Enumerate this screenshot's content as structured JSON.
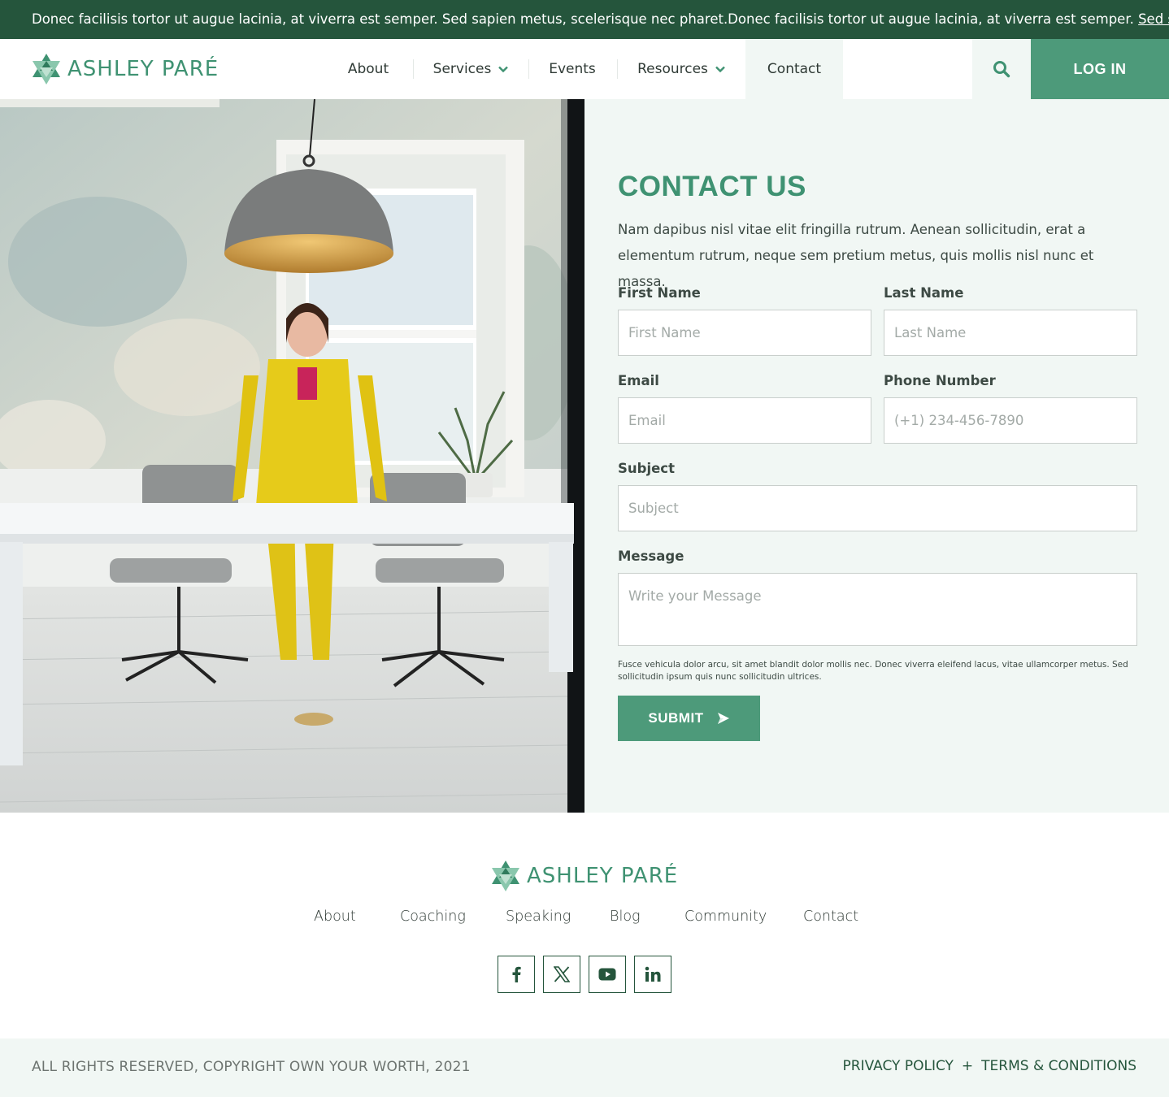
{
  "announcement": {
    "text": "Donec facilisis tortor ut augue lacinia, at viverra est semper. Sed sapien metus, scelerisque nec pharet.Donec facilisis tortor ut augue lacinia, at viverra est semper. ",
    "link": "Sed sapien",
    "trailing": "."
  },
  "brand": {
    "name": "ASHLEY PARÉ",
    "accent": "#3f9272",
    "dark_green": "#25553c",
    "button_green": "#4d9a7a",
    "panel_bg": "#f1f7f4"
  },
  "nav": {
    "items": [
      {
        "label": "About"
      },
      {
        "label": "Services",
        "icon": "chevron-down-icon"
      },
      {
        "label": "Events"
      },
      {
        "label": "Resources",
        "icon": "chevron-down-icon"
      },
      {
        "label": "Contact",
        "active": true
      }
    ],
    "search_icon": "search-icon",
    "login_label": "LOG IN"
  },
  "contact": {
    "title": "CONTACT US",
    "intro": "Nam dapibus nisl vitae elit fringilla rutrum. Aenean sollicitudin, erat a elementum rutrum, neque sem pretium metus, quis mollis nisl nunc et massa.",
    "fields": {
      "first_name": {
        "label": "First Name",
        "placeholder": "First Name"
      },
      "last_name": {
        "label": "Last Name",
        "placeholder": "Last Name"
      },
      "email": {
        "label": "Email",
        "placeholder": "Email"
      },
      "phone": {
        "label": "Phone Number",
        "placeholder": "(+1) 234-456-7890"
      },
      "subject": {
        "label": "Subject",
        "placeholder": "Subject"
      },
      "message": {
        "label": "Message",
        "placeholder": "Write your Message"
      }
    },
    "disclaimer": "Fusce vehicula dolor arcu, sit amet blandit dolor mollis nec. Donec viverra eleifend lacus, vitae ullamcorper metus. Sed sollicitudin ipsum quis nunc sollicitudin ultrices.",
    "submit_label": "SUBMIT",
    "submit_icon": "send-icon"
  },
  "footer": {
    "brand": "ASHLEY PARÉ",
    "links": [
      "About",
      "Coaching",
      "Speaking",
      "Blog",
      "Community",
      "Contact"
    ],
    "social": [
      "facebook-icon",
      "x-icon",
      "youtube-icon",
      "linkedin-icon"
    ],
    "copyright": "ALL RIGHTS RESERVED, COPYRIGHT OWN YOUR WORTH, 2021",
    "privacy": "PRIVACY POLICY",
    "separator": "+",
    "terms": "TERMS & CONDITIONS"
  }
}
